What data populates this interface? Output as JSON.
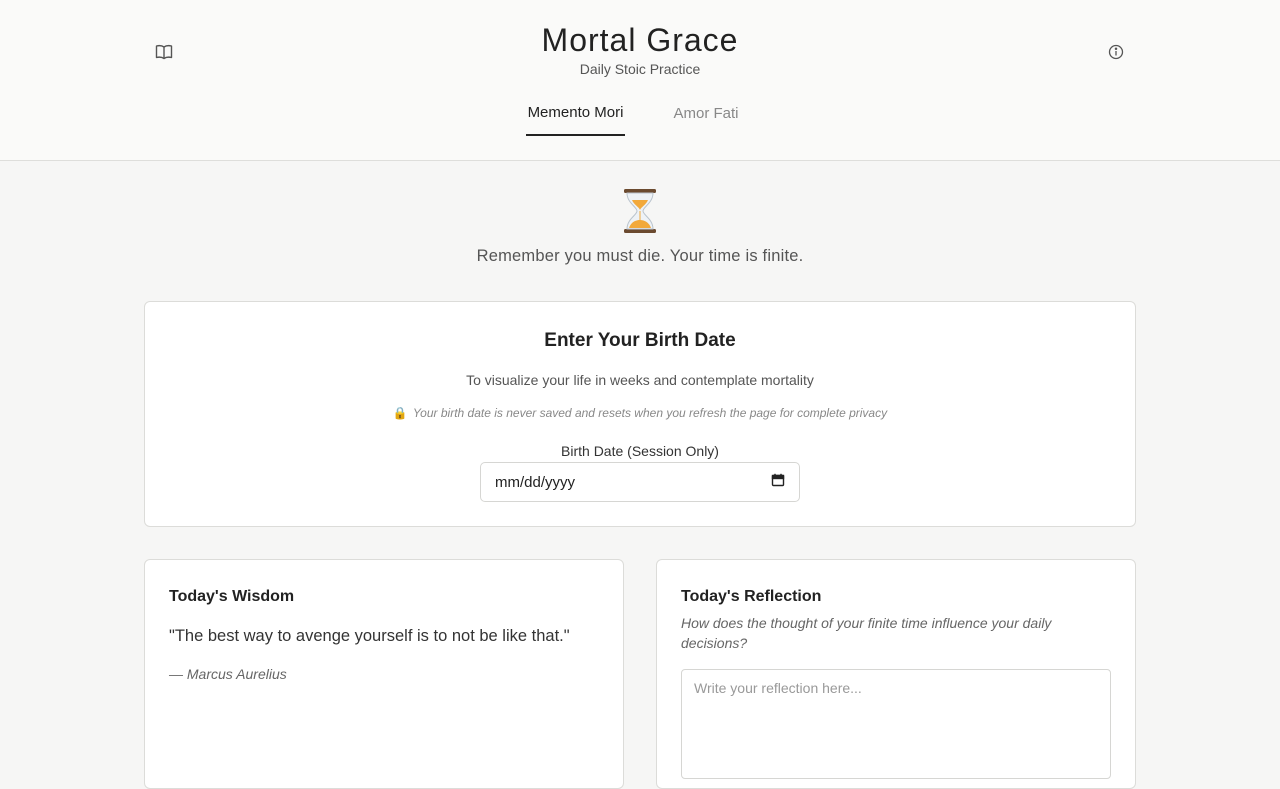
{
  "header": {
    "title": "Mortal Grace",
    "subtitle": "Daily Stoic Practice",
    "left_icon": "book-open-icon",
    "right_icon": "info-icon"
  },
  "tabs": [
    {
      "label": "Memento Mori",
      "active": true
    },
    {
      "label": "Amor Fati",
      "active": false
    }
  ],
  "hero": {
    "icon": "hourglass-icon",
    "text": "Remember you must die. Your time is finite."
  },
  "birth_card": {
    "title": "Enter Your Birth Date",
    "description": "To visualize your life in weeks and contemplate mortality",
    "privacy_icon": "lock-icon",
    "privacy_note": "Your birth date is never saved and resets when you refresh the page for complete privacy",
    "field_label": "Birth Date (Session Only)",
    "field_placeholder": "mm/dd/yyyy",
    "field_icon": "calendar-icon"
  },
  "wisdom": {
    "heading": "Today's Wisdom",
    "quote": "\"The best way to avenge yourself is to not be like that.\"",
    "author": "— Marcus Aurelius"
  },
  "reflection": {
    "heading": "Today's Reflection",
    "prompt": "How does the thought of your finite time influence your daily decisions?",
    "placeholder": "Write your reflection here..."
  },
  "colors": {
    "background": "#f6f6f5",
    "card": "#ffffff",
    "hourglass_sand": "#f2a93b",
    "hourglass_frame": "#6b4a2f",
    "lock": "#d4a017"
  }
}
